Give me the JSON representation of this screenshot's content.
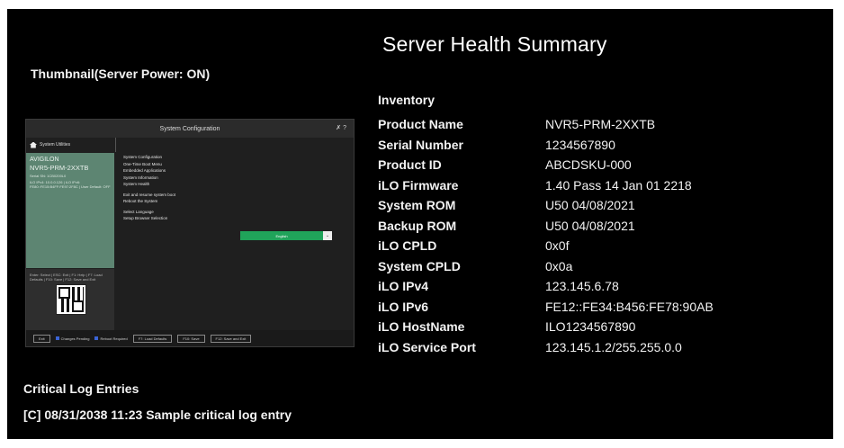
{
  "thumbnail": {
    "title": "Thumbnail(Server Power: ON)",
    "screen": {
      "header_title": "System Configuration",
      "header_tools": "✗ ?",
      "breadcrumb": "System Utilities",
      "device_line1": "AVIGILON",
      "device_line2": "NVR5-PRM-2XXTB",
      "device_serial": "Serial SN: 1CB0200L0",
      "device_info": "iLO IPv4: 10.0.0.126 | iLO IPv6: FE80::FE15:B4FF:FE97:2F8C | User Default: OFF",
      "keys_help": "Enter: Select | ESC: Exit | F1: Help | F7: Load Defaults | F10: Save | F12: Save and Exit",
      "menu": [
        "System Configuration",
        "One-Time Boot Menu",
        "Embedded Applications",
        "System Information",
        "System Health",
        "",
        "Exit and resume system boot",
        "Reboot the System",
        "",
        "Select Language",
        "Setup Browser Selection"
      ],
      "language_value": "English",
      "footer": {
        "exit": "Exit",
        "changes_pending": "Changes Pending",
        "reboot_required": "Reboot Required",
        "f7": "F7: Load Defaults",
        "f10": "F10: Save",
        "f12": "F12: Save and Exit"
      }
    }
  },
  "critical_log": {
    "title": "Critical Log Entries",
    "entries": [
      "[C] 08/31/2038 11:23 Sample critical log entry"
    ]
  },
  "summary": {
    "title": "Server Health Summary",
    "inventory_title": "Inventory",
    "rows": [
      {
        "label": "Product Name",
        "value": "NVR5-PRM-2XXTB"
      },
      {
        "label": "Serial Number",
        "value": "1234567890"
      },
      {
        "label": "Product ID",
        "value": "ABCDSKU-000"
      },
      {
        "label": "iLO Firmware",
        "value": "1.40 Pass 14 Jan 01 2218"
      },
      {
        "label": "System ROM",
        "value": "U50 04/08/2021"
      },
      {
        "label": "Backup ROM",
        "value": "U50 04/08/2021"
      },
      {
        "label": "iLO CPLD",
        "value": "0x0f"
      },
      {
        "label": "System CPLD",
        "value": "0x0a"
      },
      {
        "label": "iLO IPv4",
        "value": "123.145.6.78"
      },
      {
        "label": "iLO IPv6",
        "value": "FE12::FE34:B456:FE78:90AB"
      },
      {
        "label": "iLO HostName",
        "value": "ILO1234567890"
      },
      {
        "label": "iLO Service Port",
        "value": "123.145.1.2/255.255.0.0"
      }
    ]
  }
}
